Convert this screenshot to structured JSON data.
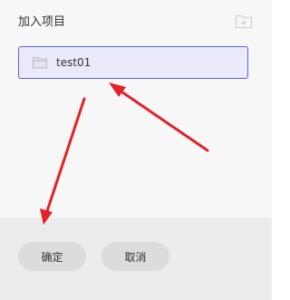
{
  "dialog": {
    "title": "加入项目",
    "new_folder_icon": "folder-plus-icon",
    "projects": [
      {
        "name": "test01",
        "selected": true,
        "icon": "folder-icon"
      }
    ],
    "buttons": {
      "confirm_label": "确定",
      "cancel_label": "取消"
    }
  },
  "colors": {
    "selection_border": "#5b63d6",
    "selection_fill": "#eaeafb",
    "annotation_arrow": "#e3212a",
    "button_fill": "#dcdcdc"
  }
}
